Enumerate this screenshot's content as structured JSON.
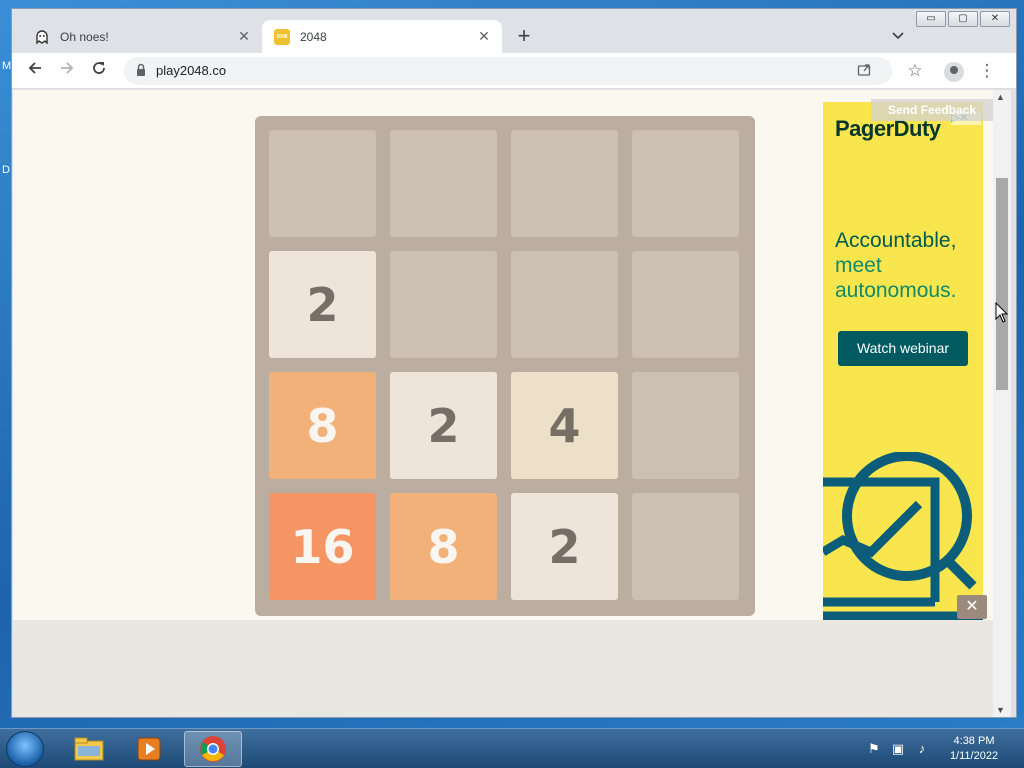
{
  "desktop": {
    "left_letters": [
      "M",
      "D"
    ]
  },
  "window": {
    "controls": [
      "▭",
      "▢",
      "✕"
    ]
  },
  "tabs": [
    {
      "title": "Oh noes!",
      "icon": "ghost-icon",
      "active": false
    },
    {
      "title": "2048",
      "icon": "2048-favicon",
      "favicon_text": "2048",
      "active": true
    }
  ],
  "toolbar": {
    "url": "play2048.co"
  },
  "game": {
    "grid": [
      [
        "",
        "",
        "",
        ""
      ],
      [
        "2",
        "",
        "",
        ""
      ],
      [
        "8",
        "2",
        "4",
        ""
      ],
      [
        "16",
        "8",
        "2",
        ""
      ]
    ],
    "colors": {
      "board": "#bbada0",
      "2": "#eee4da",
      "4": "#ede0c8",
      "8": "#f2b179",
      "16": "#f59563",
      "dark_text": "#776e65",
      "light_text": "#f9f6f2"
    }
  },
  "ad": {
    "logo": "PagerDuty",
    "headline_line1": "Accountable,",
    "headline_line2": "meet",
    "headline_line3": "autonomous.",
    "cta": "Watch webinar",
    "feedback": "Send Feedback",
    "close": "✕",
    "adchoices": "▷✕",
    "background": "#f9e64f"
  },
  "taskbar": {
    "items": [
      "file-explorer",
      "media-player",
      "chrome"
    ],
    "time": "4:38 PM",
    "date": "1/11/2022"
  }
}
